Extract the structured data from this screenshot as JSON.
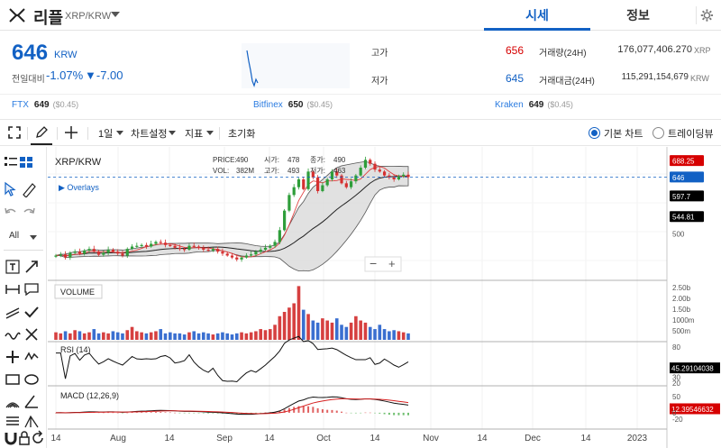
{
  "header": {
    "coin_name": "리플",
    "pair": "XRP/KRW",
    "tabs": [
      "시세",
      "정보"
    ]
  },
  "price": {
    "current": "646",
    "unit": "KRW",
    "compare_label": "전일대비",
    "change_pct": "-1.07%",
    "change_abs": "▼-7.00"
  },
  "stats": {
    "high_label": "고가",
    "high": "656",
    "low_label": "저가",
    "low": "645",
    "volume_label": "거래량(24H)",
    "volume": "176,077,406.270",
    "volume_unit": "XRP",
    "amount_label": "거래대금(24H)",
    "amount": "115,291,154,679",
    "amount_unit": "KRW"
  },
  "exchanges": [
    {
      "name": "FTX",
      "price": "649",
      "diff": "($0.45)"
    },
    {
      "name": "Bitfinex",
      "price": "650",
      "diff": "($0.45)"
    },
    {
      "name": "Kraken",
      "price": "649",
      "diff": "($0.45)"
    }
  ],
  "toolbar": {
    "interval": "1일",
    "chart_settings": "차트설정",
    "indicators": "지표",
    "reset": "초기화",
    "basic_chart": "기본 차트",
    "trading_view": "트레이딩뷰"
  },
  "sidebar": {
    "filter": "All"
  },
  "chart_panel": {
    "symbol": "XRP/KRW",
    "overlays": "▶ Overlays",
    "price_lbl": "PRICE:",
    "price_val": "490",
    "vol_lbl": "VOL:",
    "vol_val": "382M",
    "open_lbl": "시가:",
    "open_val": "478",
    "high_lbl": "고가:",
    "high_val": "493",
    "close_lbl": "종가:",
    "close_val": "490",
    "low_lbl": "저가:",
    "low_val": "463",
    "volume_title": "VOLUME",
    "rsi_title": "RSI (14)",
    "macd_title": "MACD (12,26,9)"
  },
  "chart_data": {
    "type": "candlestick",
    "x_ticks": [
      "14",
      "Aug",
      "14",
      "Sep",
      "14",
      "Oct",
      "14",
      "Nov",
      "14",
      "Dec",
      "14",
      "2023"
    ],
    "price_axis_ticks": [
      "688.25",
      "646",
      "597.7",
      "544.81",
      "500"
    ],
    "price_axis_colors": [
      "#d60000",
      "#1261c4",
      "#000000",
      "#000000",
      "none"
    ],
    "current_price_line": 646,
    "volume_axis_ticks": [
      "2.50b",
      "2.00b",
      "1.50b",
      "1000m",
      "500m"
    ],
    "rsi_axis_ticks": [
      "80",
      "45.29104038",
      "30",
      "20"
    ],
    "rsi_value": 45.29104038,
    "macd_axis_ticks": [
      "50",
      "12.39546632",
      "0",
      "-20"
    ],
    "macd_value": 12.39546632,
    "price_closes": [
      445,
      448,
      440,
      452,
      455,
      450,
      458,
      462,
      455,
      447,
      452,
      460,
      455,
      450,
      445,
      462,
      468,
      470,
      472,
      468,
      475,
      480,
      478,
      472,
      470,
      465,
      462,
      460,
      470,
      468,
      465,
      460,
      458,
      462,
      455,
      450,
      445,
      440,
      435,
      440,
      445,
      448,
      455,
      460,
      465,
      470,
      480,
      510,
      560,
      600,
      620,
      640,
      615,
      660,
      645,
      610,
      625,
      640,
      660,
      650,
      630,
      620,
      635,
      650,
      670,
      690,
      680,
      665,
      660,
      650,
      645,
      640,
      648,
      652,
      646
    ],
    "volumes": [
      0.35,
      0.3,
      0.4,
      0.3,
      0.45,
      0.4,
      0.3,
      0.35,
      0.5,
      0.3,
      0.35,
      0.3,
      0.4,
      0.35,
      0.3,
      0.45,
      0.6,
      0.4,
      0.35,
      0.3,
      0.35,
      0.4,
      0.5,
      0.3,
      0.35,
      0.3,
      0.3,
      0.25,
      0.35,
      0.4,
      0.3,
      0.35,
      0.3,
      0.25,
      0.3,
      0.35,
      0.3,
      0.25,
      0.3,
      0.35,
      0.3,
      0.35,
      0.4,
      0.5,
      0.45,
      0.5,
      0.7,
      1.1,
      1.3,
      1.5,
      1.7,
      2.5,
      1.4,
      1.2,
      0.9,
      0.8,
      1.0,
      0.9,
      0.8,
      1.0,
      0.7,
      0.6,
      0.8,
      1.1,
      0.9,
      0.8,
      0.6,
      0.5,
      0.7,
      0.5,
      0.4,
      0.45,
      0.4,
      0.35,
      0.3
    ]
  },
  "colors": {
    "accent": "#1261c4",
    "up": "#d60000",
    "down": "#1261c4"
  }
}
